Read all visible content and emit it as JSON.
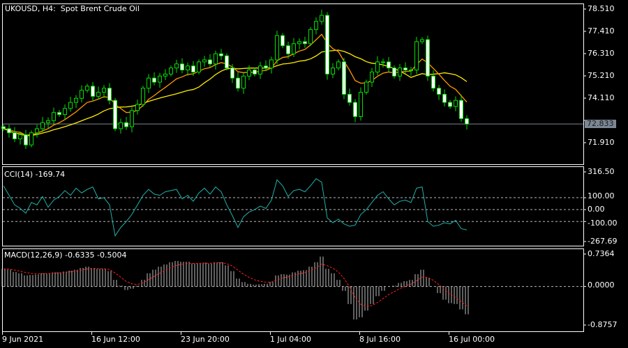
{
  "header": {
    "symbol": "UKOUSD, H4:",
    "description": "Spot Brent Crude Oil"
  },
  "colors": {
    "background": "#000000",
    "candle": "#00e000",
    "candle_bear_fill": "#ffffff",
    "ma_fast": "#ff9900",
    "ma_slow": "#ffee00",
    "cci": "#20b2aa",
    "macd_hist": "#c0c0c0",
    "macd_signal": "#ff2020",
    "last_price_line": "#7b8794"
  },
  "chart_data": [
    {
      "type": "candlestick",
      "title": "UKOUSD, H4:  Spot Brent Crude Oil",
      "y_ticks": [
        "78.510",
        "77.410",
        "76.310",
        "75.210",
        "74.110",
        "71.910"
      ],
      "ylim": [
        71.5,
        78.7
      ],
      "last_price": "72.833",
      "x_ticks": [
        "9 Jun 2021",
        "16 Jun 12:00",
        "23 Jun 20:00",
        "1 Jul 04:00",
        "8 Jul 16:00",
        "16 Jul 00:00"
      ],
      "closes": [
        72.6,
        72.4,
        72.1,
        72.3,
        71.8,
        72.4,
        72.6,
        72.9,
        73.0,
        73.4,
        73.3,
        73.6,
        73.9,
        74.1,
        74.5,
        74.7,
        74.2,
        74.4,
        74.6,
        74.0,
        72.6,
        72.9,
        72.7,
        73.5,
        73.8,
        74.6,
        75.1,
        74.9,
        75.2,
        75.3,
        75.6,
        75.8,
        75.5,
        75.7,
        75.4,
        75.9,
        76.0,
        75.8,
        76.3,
        76.2,
        75.6,
        75.1,
        74.6,
        75.2,
        75.5,
        75.3,
        75.7,
        75.6,
        76.0,
        77.2,
        76.7,
        76.3,
        76.8,
        76.9,
        76.8,
        77.5,
        77.9,
        78.2,
        75.3,
        75.6,
        75.9,
        74.3,
        73.9,
        73.2,
        74.4,
        74.9,
        75.4,
        75.9,
        75.9,
        75.6,
        75.2,
        75.6,
        75.5,
        75.5,
        76.9,
        77.0,
        75.2,
        74.6,
        74.3,
        73.9,
        73.7,
        74.0,
        73.1,
        72.833
      ],
      "moving_averages": [
        "fast",
        "slow"
      ]
    },
    {
      "type": "line",
      "label": "CCI(14) -169.74",
      "y_ticks": [
        "316.50",
        "100.00",
        "0.00",
        "-100.00",
        "-267.69"
      ],
      "ylim": [
        -267.69,
        316.5
      ],
      "levels": [
        100,
        0,
        -100
      ],
      "values": [
        200,
        120,
        40,
        10,
        -30,
        60,
        40,
        110,
        20,
        80,
        110,
        160,
        120,
        180,
        140,
        170,
        190,
        90,
        100,
        40,
        -220,
        -150,
        -100,
        -40,
        40,
        120,
        170,
        130,
        120,
        150,
        160,
        170,
        90,
        120,
        70,
        140,
        180,
        130,
        190,
        150,
        40,
        -50,
        -150,
        -60,
        -20,
        0,
        30,
        10,
        80,
        250,
        200,
        110,
        160,
        170,
        150,
        200,
        260,
        230,
        -70,
        -110,
        -80,
        -120,
        -140,
        -130,
        -40,
        0,
        60,
        120,
        150,
        90,
        40,
        70,
        80,
        60,
        180,
        190,
        -100,
        -140,
        -130,
        -110,
        -120,
        -90,
        -160,
        -169.74
      ]
    },
    {
      "type": "bar",
      "label": "MACD(12,26,9) -0.6335 -0.5004",
      "y_ticks": [
        "0.7364",
        "0.0000",
        "-0.8757"
      ],
      "ylim": [
        -0.8757,
        0.7364
      ],
      "values": [
        0.4,
        0.38,
        0.33,
        0.3,
        0.25,
        0.26,
        0.27,
        0.3,
        0.3,
        0.32,
        0.32,
        0.34,
        0.36,
        0.38,
        0.42,
        0.45,
        0.42,
        0.4,
        0.4,
        0.35,
        0.15,
        0.02,
        -0.08,
        -0.05,
        0.02,
        0.15,
        0.3,
        0.38,
        0.45,
        0.5,
        0.55,
        0.58,
        0.56,
        0.56,
        0.52,
        0.53,
        0.54,
        0.52,
        0.55,
        0.55,
        0.48,
        0.35,
        0.18,
        0.1,
        0.06,
        0.04,
        0.05,
        0.06,
        0.1,
        0.25,
        0.28,
        0.27,
        0.32,
        0.36,
        0.37,
        0.45,
        0.55,
        0.68,
        0.4,
        0.3,
        0.15,
        -0.1,
        -0.4,
        -0.75,
        -0.7,
        -0.55,
        -0.4,
        -0.22,
        -0.1,
        0.0,
        0.02,
        0.08,
        0.12,
        0.15,
        0.28,
        0.38,
        0.2,
        0.0,
        -0.15,
        -0.3,
        -0.38,
        -0.4,
        -0.52,
        -0.6335
      ],
      "signal_last": -0.5004
    }
  ]
}
